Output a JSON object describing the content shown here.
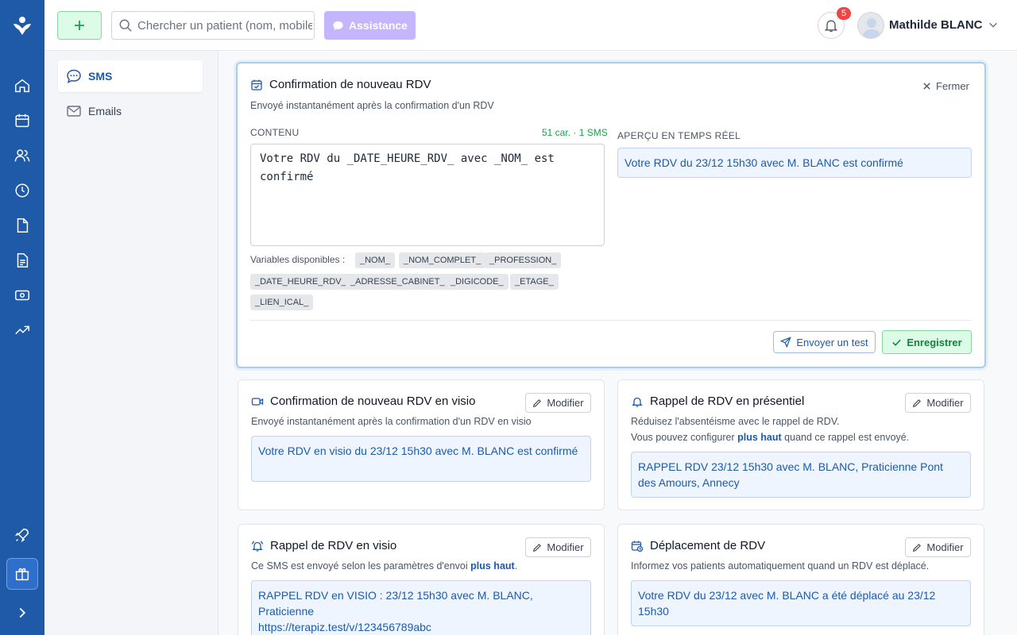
{
  "topbar": {
    "search_placeholder": "Chercher un patient (nom, mobile...)",
    "assistance_label": "Assistance",
    "notification_count": "5",
    "user_name": "Mathilde BLANC"
  },
  "sidebar": {
    "items": [
      {
        "label": "SMS",
        "icon": "chat-bubble-icon",
        "active": true
      },
      {
        "label": "Emails",
        "icon": "envelope-icon",
        "active": false
      }
    ]
  },
  "rail": {
    "items": [
      "home-icon",
      "calendar-icon",
      "users-icon",
      "clock-icon",
      "document-icon",
      "invoice-icon",
      "cash-icon",
      "trending-up-icon",
      "rocket-icon",
      "gift-icon",
      "chevron-right-icon"
    ]
  },
  "editor": {
    "title": "Confirmation de nouveau RDV",
    "description": "Envoyé instantanément après la confirmation d'un RDV",
    "close_label": "Fermer",
    "content_label": "CONTENU",
    "counter": "51 car. · 1 SMS",
    "content_value": "Votre RDV du _DATE_HEURE_RDV_ avec _NOM_ est confirmé",
    "preview_label": "APERÇU EN TEMPS RÉEL",
    "preview_text": "Votre RDV du 23/12 15h30 avec M. BLANC est confirmé",
    "variables_label": "Variables disponibles :",
    "variables": [
      "_NOM_",
      "_NOM_COMPLET_",
      "_PROFESSION_",
      "_DATE_HEURE_RDV_",
      "_ADRESSE_CABINET_",
      "_DIGICODE_",
      "_ETAGE_",
      "_LIEN_ICAL_"
    ],
    "send_test_label": "Envoyer un test",
    "save_label": "Enregistrer"
  },
  "cards": [
    {
      "title": "Confirmation de nouveau RDV en visio",
      "icon": "video-icon",
      "description": "Envoyé instantanément après la confirmation d'un RDV en visio",
      "preview": "Votre RDV en visio du 23/12 15h30 avec M. BLANC est confirmé",
      "button": "Modifier"
    },
    {
      "title": "Rappel de RDV en présentiel",
      "icon": "bell-icon",
      "description_line1": "Réduisez l'absentéisme avec le rappel de RDV.",
      "description_pre": "Vous pouvez configurer ",
      "description_link": "plus haut",
      "description_post": " quand ce rappel est envoyé.",
      "preview": "RAPPEL RDV 23/12 15h30 avec M. BLANC, Praticienne Pont des Amours, Annecy",
      "button": "Modifier"
    },
    {
      "title": "Rappel de RDV en visio",
      "icon": "bell-ring-icon",
      "description_pre": "Ce SMS est envoyé selon les paramètres d'envoi ",
      "description_link": "plus haut",
      "description_post": ".",
      "preview_line1": "RAPPEL RDV en VISIO : 23/12 15h30 avec M. BLANC,",
      "preview_line2": "Praticienne",
      "preview_line3": "https://terapiz.test/v/123456789abc",
      "button": "Modifier"
    },
    {
      "title": "Déplacement de RDV",
      "icon": "calendar-clock-icon",
      "description": "Informez vos patients automatiquement quand un RDV est déplacé.",
      "preview": "Votre RDV du 23/12 avec M. BLANC a été déplacé au 23/12 15h30",
      "button": "Modifier"
    }
  ]
}
